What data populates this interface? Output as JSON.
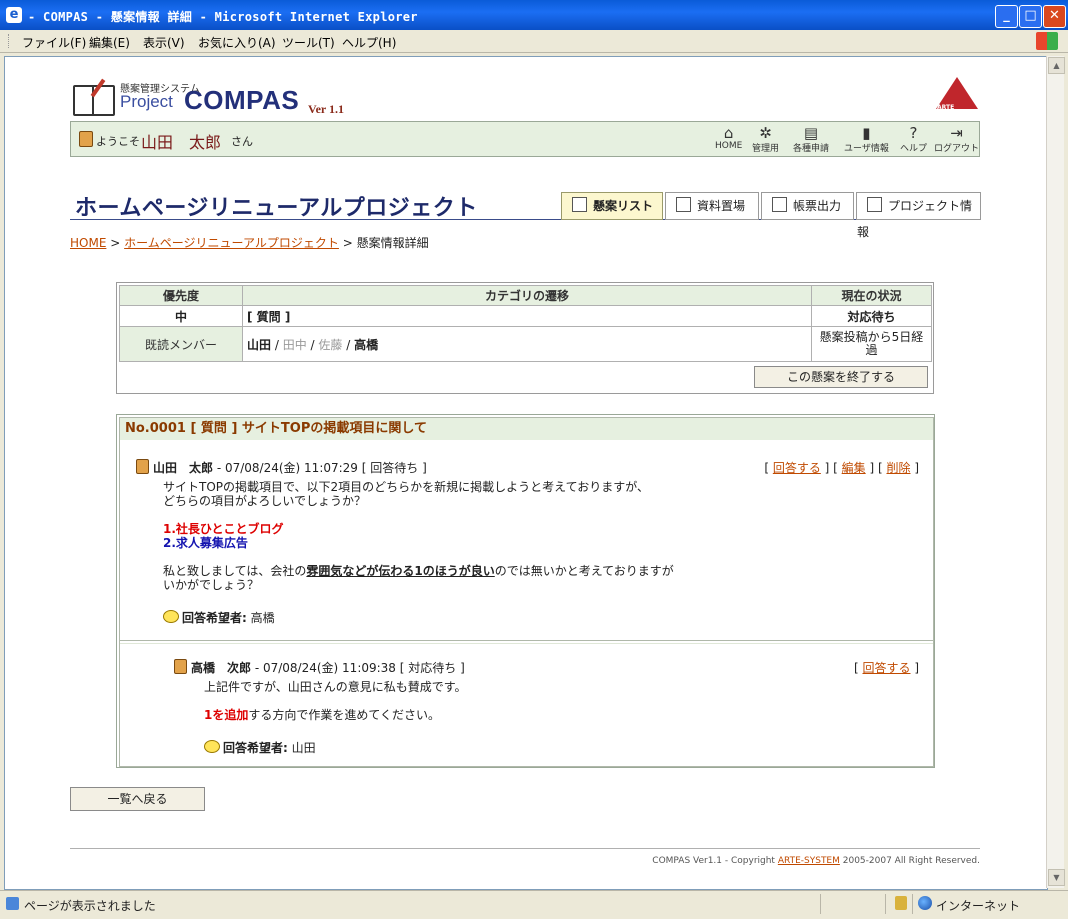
{
  "window": {
    "title": "- COMPAS - 懸案情報 詳細 - Microsoft Internet Explorer",
    "menu": [
      "ファイル(F)",
      "編集(E)",
      "表示(V)",
      "お気に入り(A)",
      "ツール(T)",
      "ヘルプ(H)"
    ]
  },
  "statusbar": {
    "text": "ページが表示されました",
    "zone": "インターネット"
  },
  "logo": {
    "subtitle": "懸案管理システム",
    "project": "Project",
    "compas": "COMPAS",
    "version": "Ver 1.1",
    "brand": "ARTE"
  },
  "welcome": {
    "prefix": "ようこそ",
    "name": "山田　太郎",
    "suffix": "さん"
  },
  "topnav": [
    "HOME",
    "管理用",
    "各種申請",
    "ユーザ情報",
    "ヘルプ",
    "ログアウト"
  ],
  "page": {
    "title": "ホームページリニューアルプロジェクト"
  },
  "tabs": [
    "懸案リスト",
    "資料置場",
    "帳票出力",
    "プロジェクト情報"
  ],
  "breadcrumb": {
    "home": "HOME",
    "project": "ホームページリニューアルプロジェクト",
    "current": "懸案情報詳細",
    "sep": ">"
  },
  "status": {
    "h_priority": "優先度",
    "h_category": "カテゴリの遷移",
    "h_state": "現在の状況",
    "priority": "中",
    "category": "[ 質問 ]",
    "state": "対応待ち",
    "read_label": "既読メンバー",
    "members": [
      "山田",
      "田中",
      "佐藤",
      "高橋"
    ],
    "elapsed_1": "懸案投稿から5日経",
    "elapsed_2": "過",
    "close_button": "この懸案を終了する"
  },
  "post": {
    "heading": "No.0001 [ 質問 ] サイトTOPの掲載項目に関して",
    "p1": {
      "author": "山田　太郎",
      "meta": " - 07/08/24(金) 11:07:29 [ 回答待ち ]",
      "actions": [
        "回答する",
        "編集",
        "削除"
      ],
      "line1": "サイトTOPの掲載項目で、以下2項目のどちらかを新規に掲載しようと考えておりますが、",
      "line2": "どちらの項目がよろしいでしょうか？",
      "item1": "1.社長ひとことブログ",
      "item2": "2.求人募集広告",
      "line3a": "私と致しましては、会社の",
      "line3b": "雰囲気などが伝わる1のほうが良い",
      "line3c": "のでは無いかと考えておりますが",
      "line4": "いかがでしょう？",
      "hope_label": "回答希望者:",
      "hope_value": "高橋"
    },
    "p2": {
      "author": "高橋　次郎",
      "meta": " - 07/08/24(金) 11:09:38 [ 対応待ち ]",
      "actions": [
        "回答する"
      ],
      "line1": "上記件ですが、山田さんの意見に私も賛成です。",
      "line2a": "1を追加",
      "line2b": "する方向で作業を進めてください。",
      "hope_label": "回答希望者:",
      "hope_value": "山田"
    }
  },
  "back_button": "一覧へ戻る",
  "footer": {
    "pre": "COMPAS Ver1.1 - Copyright ",
    "link": "ARTE-SYSTEM",
    "post": " 2005-2007 All Right Reserved."
  }
}
